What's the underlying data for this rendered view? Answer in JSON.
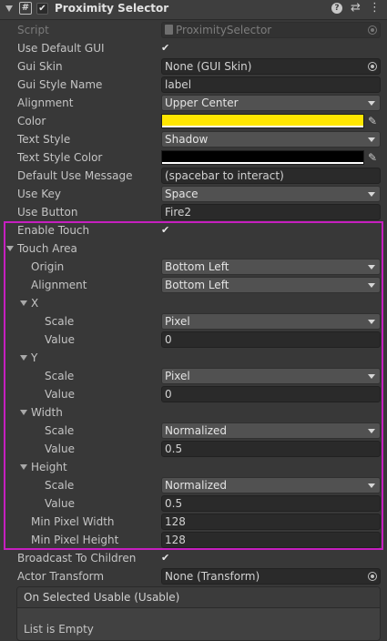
{
  "component": {
    "title": "Proximity Selector",
    "enabled": true
  },
  "icons": {
    "fold": "triangle-down-icon",
    "script": "hash-script-icon",
    "help": "help-icon",
    "preset": "preset-sliders-icon",
    "menu": "kebab-menu-icon",
    "picker": "eyedropper-icon"
  },
  "glyphs": {
    "check": "✔",
    "hash": "#",
    "help": "?",
    "preset": "⇄",
    "menu": "⋮",
    "picker": "✎"
  },
  "colors": {
    "color_field": "#ffe600",
    "text_style_color": "#000000",
    "touch_highlight": "#c61fbf"
  },
  "fields": {
    "script": {
      "label": "Script",
      "value": "ProximitySelector"
    },
    "use_default_gui": {
      "label": "Use Default GUI",
      "checked": true
    },
    "gui_skin": {
      "label": "Gui Skin",
      "value": "None (GUI Skin)"
    },
    "gui_style_name": {
      "label": "Gui Style Name",
      "value": "label"
    },
    "alignment": {
      "label": "Alignment",
      "value": "Upper Center"
    },
    "color": {
      "label": "Color"
    },
    "text_style": {
      "label": "Text Style",
      "value": "Shadow"
    },
    "text_style_color": {
      "label": "Text Style Color"
    },
    "default_use_message": {
      "label": "Default Use Message",
      "value": "(spacebar to interact)"
    },
    "use_key": {
      "label": "Use Key",
      "value": "Space"
    },
    "use_button": {
      "label": "Use Button",
      "value": "Fire2"
    },
    "enable_touch": {
      "label": "Enable Touch",
      "checked": true
    },
    "touch_area": {
      "label": "Touch Area"
    },
    "origin": {
      "label": "Origin",
      "value": "Bottom Left"
    },
    "touch_alignment": {
      "label": "Alignment",
      "value": "Bottom Left"
    },
    "x": {
      "label": "X",
      "scale_label": "Scale",
      "scale": "Pixel",
      "value_label": "Value",
      "value": "0"
    },
    "y": {
      "label": "Y",
      "scale_label": "Scale",
      "scale": "Pixel",
      "value_label": "Value",
      "value": "0"
    },
    "width": {
      "label": "Width",
      "scale_label": "Scale",
      "scale": "Normalized",
      "value_label": "Value",
      "value": "0.5"
    },
    "height": {
      "label": "Height",
      "scale_label": "Scale",
      "scale": "Normalized",
      "value_label": "Value",
      "value": "0.5"
    },
    "min_pixel_width": {
      "label": "Min Pixel Width",
      "value": "128"
    },
    "min_pixel_height": {
      "label": "Min Pixel Height",
      "value": "128"
    },
    "broadcast_to_children": {
      "label": "Broadcast To Children",
      "checked": true
    },
    "actor_transform": {
      "label": "Actor Transform",
      "value": "None (Transform)"
    }
  },
  "event": {
    "title": "On Selected Usable (Usable)",
    "empty_text": "List is Empty"
  }
}
